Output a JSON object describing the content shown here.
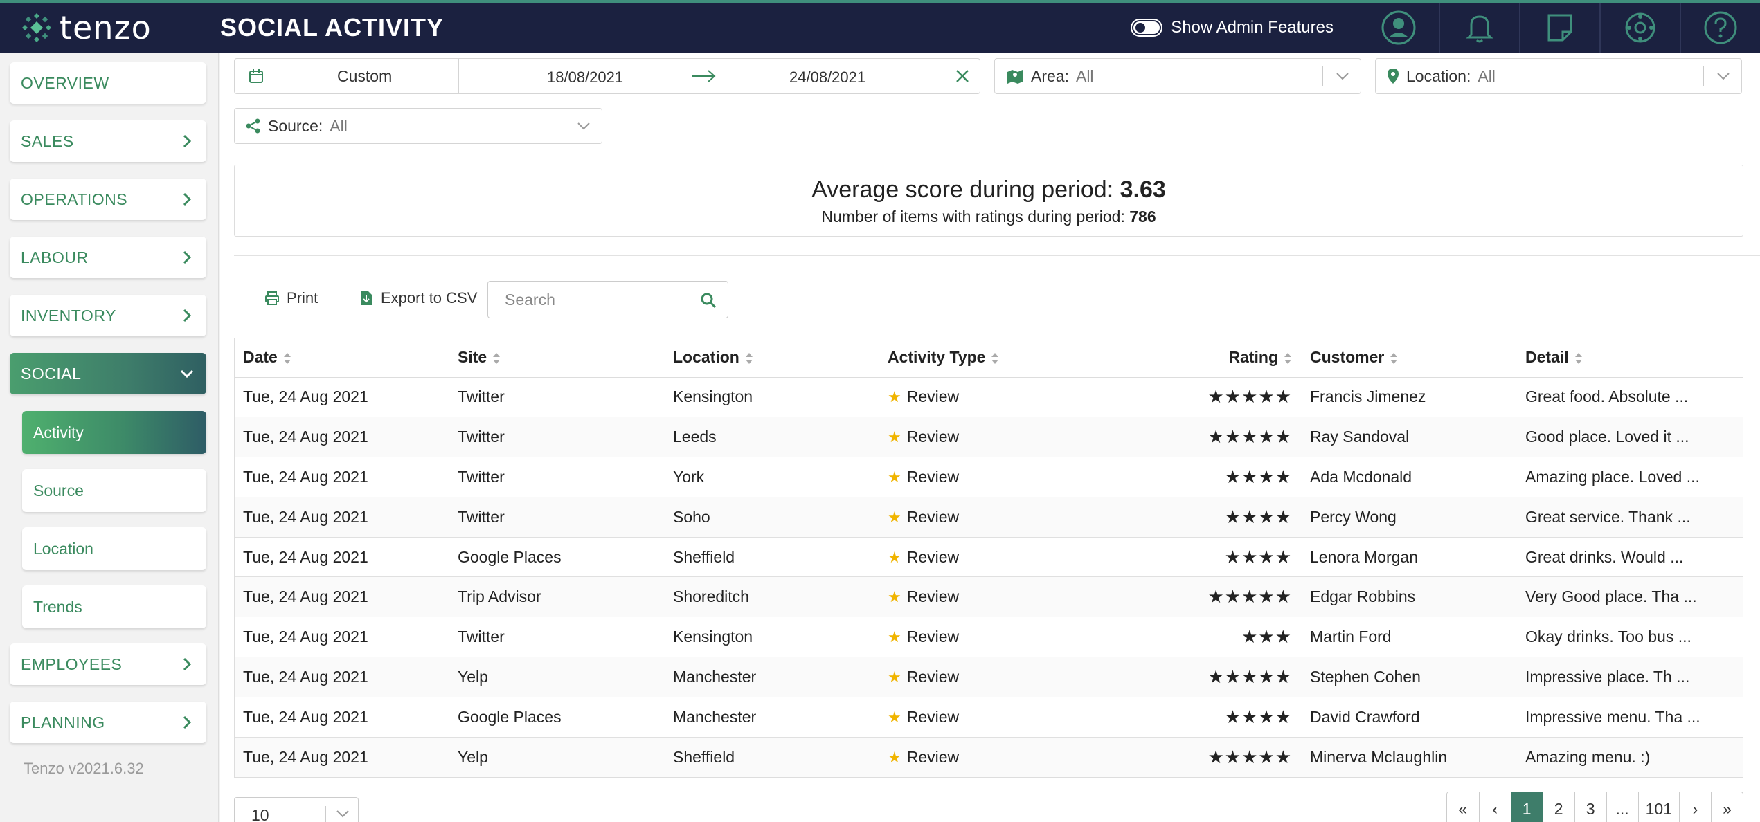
{
  "brand": {
    "name": "tenzo"
  },
  "header": {
    "title": "SOCIAL ACTIVITY",
    "admin_label": "Show Admin Features",
    "icons": [
      "user-icon",
      "bell-icon",
      "note-icon",
      "settings-icon",
      "help-icon"
    ]
  },
  "sidebar": {
    "items": [
      {
        "label": "OVERVIEW"
      },
      {
        "label": "SALES"
      },
      {
        "label": "OPERATIONS"
      },
      {
        "label": "LABOUR"
      },
      {
        "label": "INVENTORY"
      },
      {
        "label": "SOCIAL"
      }
    ],
    "sub_items": [
      {
        "label": "Activity"
      },
      {
        "label": "Source"
      },
      {
        "label": "Location"
      },
      {
        "label": "Trends"
      }
    ],
    "bottom_items": [
      {
        "label": "EMPLOYEES"
      },
      {
        "label": "PLANNING"
      }
    ],
    "version": "Tenzo v2021.6.32"
  },
  "filters": {
    "date_mode": "Custom",
    "date_from": "18/08/2021",
    "date_to": "24/08/2021",
    "area_label": "Area:",
    "area_value": "All",
    "location_label": "Location:",
    "location_value": "All",
    "source_label": "Source:",
    "source_value": "All"
  },
  "summary": {
    "avg_label": "Average score during period:",
    "avg_value": "3.63",
    "count_label": "Number of items with ratings during period:",
    "count_value": "786"
  },
  "toolbar": {
    "print_label": "Print",
    "export_label": "Export to CSV",
    "search_placeholder": "Search"
  },
  "table": {
    "headers": [
      "Date",
      "Site",
      "Location",
      "Activity Type",
      "Rating",
      "Customer",
      "Detail"
    ],
    "rows": [
      {
        "date": "Tue, 24 Aug 2021",
        "site": "Twitter",
        "location": "Kensington",
        "type": "Review",
        "rating": 5,
        "customer": "Francis Jimenez",
        "detail": "Great food. Absolute ..."
      },
      {
        "date": "Tue, 24 Aug 2021",
        "site": "Twitter",
        "location": "Leeds",
        "type": "Review",
        "rating": 5,
        "customer": "Ray Sandoval",
        "detail": "Good place. Loved it ..."
      },
      {
        "date": "Tue, 24 Aug 2021",
        "site": "Twitter",
        "location": "York",
        "type": "Review",
        "rating": 4,
        "customer": "Ada Mcdonald",
        "detail": "Amazing place. Loved ..."
      },
      {
        "date": "Tue, 24 Aug 2021",
        "site": "Twitter",
        "location": "Soho",
        "type": "Review",
        "rating": 4,
        "customer": "Percy Wong",
        "detail": "Great service. Thank ..."
      },
      {
        "date": "Tue, 24 Aug 2021",
        "site": "Google Places",
        "location": "Sheffield",
        "type": "Review",
        "rating": 4,
        "customer": "Lenora Morgan",
        "detail": "Great drinks. Would ..."
      },
      {
        "date": "Tue, 24 Aug 2021",
        "site": "Trip Advisor",
        "location": "Shoreditch",
        "type": "Review",
        "rating": 5,
        "customer": "Edgar Robbins",
        "detail": "Very Good place. Tha ..."
      },
      {
        "date": "Tue, 24 Aug 2021",
        "site": "Twitter",
        "location": "Kensington",
        "type": "Review",
        "rating": 3,
        "customer": "Martin Ford",
        "detail": "Okay drinks. Too bus ..."
      },
      {
        "date": "Tue, 24 Aug 2021",
        "site": "Yelp",
        "location": "Manchester",
        "type": "Review",
        "rating": 5,
        "customer": "Stephen Cohen",
        "detail": "Impressive place. Th ..."
      },
      {
        "date": "Tue, 24 Aug 2021",
        "site": "Google Places",
        "location": "Manchester",
        "type": "Review",
        "rating": 4,
        "customer": "David Crawford",
        "detail": "Impressive menu. Tha ..."
      },
      {
        "date": "Tue, 24 Aug 2021",
        "site": "Yelp",
        "location": "Sheffield",
        "type": "Review",
        "rating": 5,
        "customer": "Minerva Mclaughlin",
        "detail": "Amazing menu. :)"
      }
    ]
  },
  "pagination": {
    "page_size": "10",
    "pages": [
      "«",
      "‹",
      "1",
      "2",
      "3",
      "...",
      "101",
      "›",
      "»"
    ],
    "current": "1"
  },
  "colors": {
    "header_bg": "#1b2140",
    "accent_green": "#3a8a5e",
    "active_page": "#3e7d6a"
  }
}
